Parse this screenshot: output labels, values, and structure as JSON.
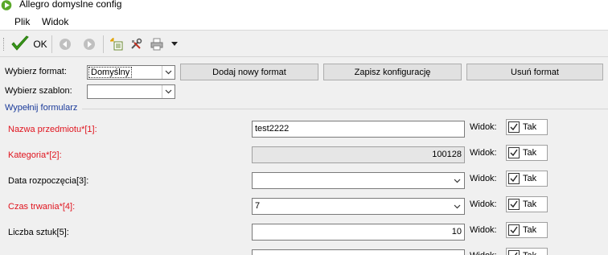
{
  "window": {
    "title": "Allegro domyslne config"
  },
  "menu": {
    "items": [
      "Plik",
      "Widok"
    ]
  },
  "toolbar": {
    "ok_label": "OK"
  },
  "format": {
    "label": "Wybierz format:",
    "value": "Domyślny",
    "add_button": "Dodaj nowy format",
    "save_button": "Zapisz konfigurację",
    "delete_button": "Usuń format"
  },
  "template": {
    "label": "Wybierz szablon:",
    "value": ""
  },
  "form": {
    "group_label": "Wypełnij formularz",
    "view_label": "Widok:",
    "check_label": "Tak",
    "fields": [
      {
        "label": "Nazwa przedmiotu*[1]:",
        "value": "test2222",
        "required": true,
        "type": "text",
        "checked": true
      },
      {
        "label": "Kategoria*[2]:",
        "value": "100128",
        "required": true,
        "type": "readonly",
        "checked": true
      },
      {
        "label": "Data rozpoczęcia[3]:",
        "value": "",
        "required": false,
        "type": "combo",
        "checked": true
      },
      {
        "label": "Czas trwania*[4]:",
        "value": "7",
        "required": true,
        "type": "combo",
        "checked": true
      },
      {
        "label": "Liczba sztuk[5]:",
        "value": "10",
        "required": false,
        "type": "number",
        "checked": true
      },
      {
        "label": "",
        "value": "",
        "required": false,
        "type": "text",
        "checked": true
      }
    ]
  },
  "colors": {
    "required": "#e0141e",
    "group": "#1a3a9a",
    "ok_check": "#3a9a1a"
  }
}
